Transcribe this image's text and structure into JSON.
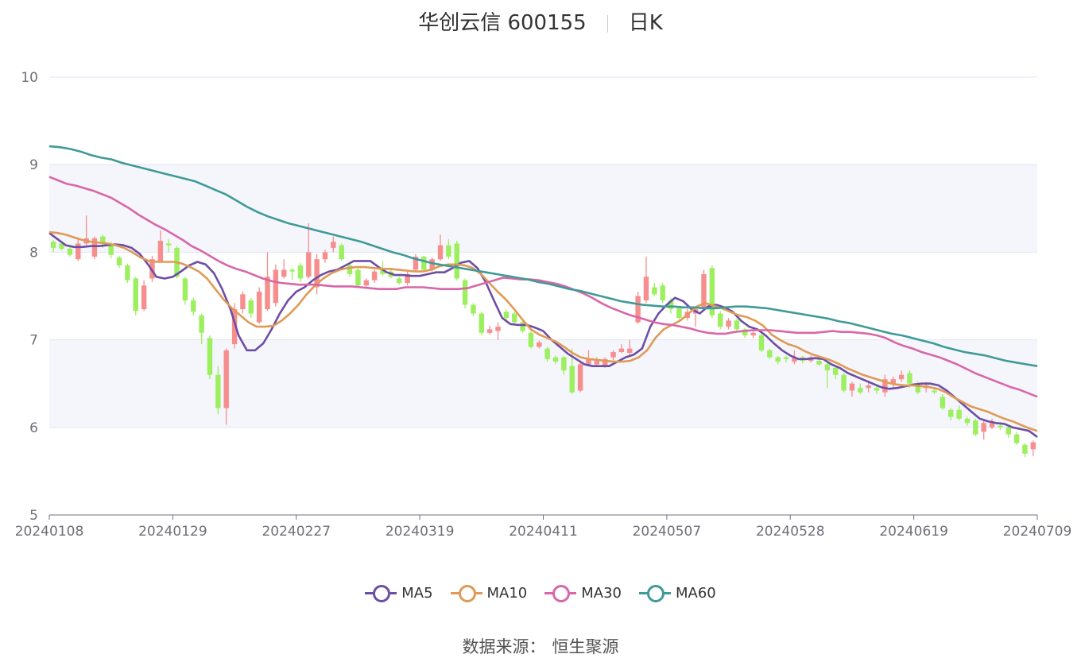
{
  "header": {
    "stock": "华创云信 600155",
    "period": "日K"
  },
  "source": {
    "label": "数据来源：",
    "provider": "恒生聚源"
  },
  "colors": {
    "up": "#f78e8e",
    "down": "#9cef5e",
    "ma5": "#6d4ea5",
    "ma10": "#e09a56",
    "ma30": "#d966a8",
    "ma60": "#3f9a98",
    "band": "#f4f6fb",
    "grid": "#dfe6f3"
  },
  "chart_data": {
    "type": "candlestick",
    "yaxis": {
      "min": 5,
      "max": 10,
      "ticks": [
        "5",
        "6",
        "7",
        "8",
        "9",
        "10"
      ]
    },
    "xaxis": {
      "ticks": [
        "20240108",
        "20240129",
        "20240227",
        "20240319",
        "20240411",
        "20240507",
        "20240528",
        "20240619",
        "20240709"
      ]
    },
    "legend": [
      "MA5",
      "MA10",
      "MA30",
      "MA60"
    ],
    "series": [
      {
        "name": "MA5",
        "values": [
          8.22,
          8.15,
          8.08,
          8.06,
          8.06,
          8.07,
          8.07,
          8.08,
          8.09,
          8.08,
          8.05,
          7.98,
          7.86,
          7.72,
          7.7,
          7.72,
          7.78,
          7.85,
          7.89,
          7.86,
          7.76,
          7.58,
          7.35,
          7.05,
          6.88,
          6.88,
          6.96,
          7.12,
          7.3,
          7.45,
          7.55,
          7.6,
          7.68,
          7.74,
          7.78,
          7.8,
          7.85,
          7.9,
          7.9,
          7.9,
          7.83,
          7.77,
          7.74,
          7.74,
          7.73,
          7.73,
          7.75,
          7.77,
          7.77,
          7.82,
          7.88,
          7.9,
          7.82,
          7.66,
          7.45,
          7.25,
          7.18,
          7.17,
          7.17,
          7.14,
          7.1,
          7.0,
          6.92,
          6.84,
          6.78,
          6.72,
          6.7,
          6.7,
          6.7,
          6.75,
          6.8,
          6.83,
          6.9,
          7.15,
          7.3,
          7.4,
          7.48,
          7.44,
          7.35,
          7.3,
          7.38,
          7.4,
          7.37,
          7.32,
          7.22,
          7.15,
          7.12,
          7.05,
          6.96,
          6.88,
          6.82,
          6.78,
          6.78,
          6.79,
          6.78,
          6.72,
          6.68,
          6.62,
          6.58,
          6.54,
          6.5,
          6.46,
          6.44,
          6.45,
          6.47,
          6.49,
          6.5,
          6.5,
          6.48,
          6.42,
          6.34,
          6.26,
          6.18,
          6.1,
          6.07,
          6.05,
          6.04,
          6.0,
          5.98,
          5.96,
          5.89
        ]
      },
      {
        "name": "MA10",
        "values": [
          8.23,
          8.22,
          8.2,
          8.17,
          8.14,
          8.12,
          8.11,
          8.1,
          8.08,
          8.05,
          8.0,
          7.94,
          7.9,
          7.89,
          7.89,
          7.89,
          7.87,
          7.83,
          7.78,
          7.7,
          7.58,
          7.46,
          7.36,
          7.28,
          7.2,
          7.15,
          7.15,
          7.16,
          7.22,
          7.3,
          7.4,
          7.52,
          7.62,
          7.7,
          7.76,
          7.8,
          7.82,
          7.83,
          7.83,
          7.82,
          7.81,
          7.81,
          7.8,
          7.79,
          7.78,
          7.78,
          7.8,
          7.84,
          7.86,
          7.86,
          7.85,
          7.82,
          7.75,
          7.65,
          7.55,
          7.46,
          7.35,
          7.23,
          7.12,
          7.06,
          7.02,
          6.98,
          6.92,
          6.85,
          6.8,
          6.78,
          6.77,
          6.76,
          6.75,
          6.75,
          6.76,
          6.8,
          6.88,
          7.02,
          7.12,
          7.17,
          7.22,
          7.3,
          7.38,
          7.42,
          7.39,
          7.36,
          7.32,
          7.28,
          7.26,
          7.22,
          7.16,
          7.06,
          7.0,
          6.95,
          6.92,
          6.87,
          6.83,
          6.8,
          6.77,
          6.73,
          6.68,
          6.64,
          6.6,
          6.57,
          6.54,
          6.51,
          6.49,
          6.48,
          6.48,
          6.47,
          6.46,
          6.44,
          6.4,
          6.34,
          6.29,
          6.24,
          6.21,
          6.18,
          6.14,
          6.1,
          6.07,
          6.03,
          5.99,
          5.96
        ]
      },
      {
        "name": "MA30",
        "values": [
          8.86,
          8.82,
          8.78,
          8.76,
          8.73,
          8.7,
          8.66,
          8.62,
          8.56,
          8.5,
          8.43,
          8.37,
          8.31,
          8.26,
          8.2,
          8.14,
          8.07,
          8.02,
          7.96,
          7.9,
          7.85,
          7.81,
          7.78,
          7.74,
          7.7,
          7.67,
          7.65,
          7.64,
          7.63,
          7.63,
          7.63,
          7.62,
          7.61,
          7.61,
          7.61,
          7.6,
          7.59,
          7.58,
          7.58,
          7.58,
          7.6,
          7.6,
          7.6,
          7.59,
          7.58,
          7.58,
          7.58,
          7.59,
          7.62,
          7.65,
          7.68,
          7.71,
          7.7,
          7.69,
          7.69,
          7.68,
          7.66,
          7.64,
          7.61,
          7.57,
          7.53,
          7.48,
          7.42,
          7.37,
          7.33,
          7.29,
          7.26,
          7.23,
          7.2,
          7.18,
          7.17,
          7.15,
          7.13,
          7.1,
          7.08,
          7.07,
          7.07,
          7.09,
          7.1,
          7.11,
          7.11,
          7.11,
          7.1,
          7.09,
          7.08,
          7.08,
          7.08,
          7.09,
          7.1,
          7.09,
          7.09,
          7.08,
          7.07,
          7.05,
          7.02,
          6.97,
          6.93,
          6.9,
          6.86,
          6.83,
          6.8,
          6.76,
          6.72,
          6.67,
          6.62,
          6.58,
          6.54,
          6.5,
          6.46,
          6.43,
          6.39,
          6.35
        ]
      },
      {
        "name": "MA60",
        "values": [
          9.21,
          9.2,
          9.18,
          9.15,
          9.11,
          9.08,
          9.06,
          9.02,
          8.99,
          8.96,
          8.93,
          8.9,
          8.87,
          8.84,
          8.81,
          8.76,
          8.71,
          8.66,
          8.59,
          8.52,
          8.46,
          8.41,
          8.37,
          8.33,
          8.3,
          8.27,
          8.24,
          8.21,
          8.18,
          8.15,
          8.12,
          8.08,
          8.04,
          8.0,
          7.97,
          7.93,
          7.9,
          7.87,
          7.85,
          7.83,
          7.81,
          7.79,
          7.77,
          7.75,
          7.73,
          7.71,
          7.69,
          7.66,
          7.64,
          7.61,
          7.58,
          7.56,
          7.53,
          7.5,
          7.47,
          7.44,
          7.42,
          7.4,
          7.39,
          7.38,
          7.38,
          7.37,
          7.37,
          7.36,
          7.36,
          7.37,
          7.38,
          7.38,
          7.37,
          7.36,
          7.34,
          7.32,
          7.3,
          7.28,
          7.26,
          7.24,
          7.21,
          7.19,
          7.16,
          7.13,
          7.1,
          7.07,
          7.05,
          7.02,
          6.99,
          6.96,
          6.92,
          6.89,
          6.86,
          6.84,
          6.82,
          6.79,
          6.76,
          6.74,
          6.72,
          6.7
        ]
      }
    ],
    "candles": [
      {
        "o": 8.12,
        "c": 8.05,
        "h": 8.14,
        "l": 8.0
      },
      {
        "o": 8.1,
        "c": 8.04,
        "h": 8.12,
        "l": 8.02
      },
      {
        "o": 8.04,
        "c": 7.97,
        "h": 8.06,
        "l": 7.95
      },
      {
        "o": 7.92,
        "c": 8.1,
        "h": 8.15,
        "l": 7.9
      },
      {
        "o": 8.1,
        "c": 8.16,
        "h": 8.42,
        "l": 8.08
      },
      {
        "o": 7.95,
        "c": 8.16,
        "h": 8.18,
        "l": 7.92
      },
      {
        "o": 8.18,
        "c": 8.1,
        "h": 8.2,
        "l": 8.05
      },
      {
        "o": 8.1,
        "c": 7.97,
        "h": 8.12,
        "l": 7.93
      },
      {
        "o": 7.94,
        "c": 7.85,
        "h": 7.96,
        "l": 7.82
      },
      {
        "o": 7.85,
        "c": 7.68,
        "h": 7.87,
        "l": 7.65
      },
      {
        "o": 7.7,
        "c": 7.33,
        "h": 7.72,
        "l": 7.28
      },
      {
        "o": 7.35,
        "c": 7.62,
        "h": 7.68,
        "l": 7.33
      },
      {
        "o": 7.7,
        "c": 7.92,
        "h": 7.96,
        "l": 7.66
      },
      {
        "o": 7.9,
        "c": 8.13,
        "h": 8.25,
        "l": 7.88
      },
      {
        "o": 8.1,
        "c": 8.08,
        "h": 8.15,
        "l": 8.0
      },
      {
        "o": 8.05,
        "c": 7.72,
        "h": 8.07,
        "l": 7.7
      },
      {
        "o": 7.7,
        "c": 7.45,
        "h": 7.72,
        "l": 7.4
      },
      {
        "o": 7.45,
        "c": 7.32,
        "h": 7.48,
        "l": 7.28
      },
      {
        "o": 7.28,
        "c": 7.08,
        "h": 7.3,
        "l": 6.95
      },
      {
        "o": 7.02,
        "c": 6.6,
        "h": 7.05,
        "l": 6.55
      },
      {
        "o": 6.6,
        "c": 6.22,
        "h": 6.7,
        "l": 6.15
      },
      {
        "o": 6.22,
        "c": 6.88,
        "h": 6.9,
        "l": 6.03
      },
      {
        "o": 6.95,
        "c": 7.35,
        "h": 7.42,
        "l": 6.9
      },
      {
        "o": 7.35,
        "c": 7.52,
        "h": 7.55,
        "l": 7.3
      },
      {
        "o": 7.45,
        "c": 7.3,
        "h": 7.48,
        "l": 7.25
      },
      {
        "o": 7.2,
        "c": 7.55,
        "h": 7.6,
        "l": 7.18
      },
      {
        "o": 7.35,
        "c": 7.72,
        "h": 8.0,
        "l": 7.33
      },
      {
        "o": 7.42,
        "c": 7.8,
        "h": 7.86,
        "l": 7.38
      },
      {
        "o": 7.72,
        "c": 7.8,
        "h": 7.92,
        "l": 7.7
      },
      {
        "o": 7.8,
        "c": 7.78,
        "h": 7.82,
        "l": 7.68
      },
      {
        "o": 7.85,
        "c": 7.7,
        "h": 7.88,
        "l": 7.66
      },
      {
        "o": 7.72,
        "c": 8.0,
        "h": 8.33,
        "l": 7.7
      },
      {
        "o": 7.6,
        "c": 7.92,
        "h": 7.98,
        "l": 7.52
      },
      {
        "o": 7.92,
        "c": 8.0,
        "h": 8.03,
        "l": 7.88
      },
      {
        "o": 8.05,
        "c": 8.12,
        "h": 8.18,
        "l": 8.0
      },
      {
        "o": 8.08,
        "c": 7.92,
        "h": 8.1,
        "l": 7.9
      },
      {
        "o": 7.85,
        "c": 7.75,
        "h": 7.87,
        "l": 7.72
      },
      {
        "o": 7.8,
        "c": 7.62,
        "h": 7.82,
        "l": 7.6
      },
      {
        "o": 7.62,
        "c": 7.68,
        "h": 7.7,
        "l": 7.6
      },
      {
        "o": 7.68,
        "c": 7.78,
        "h": 7.8,
        "l": 7.65
      },
      {
        "o": 7.8,
        "c": 7.75,
        "h": 7.9,
        "l": 7.73
      },
      {
        "o": 7.78,
        "c": 7.72,
        "h": 7.8,
        "l": 7.7
      },
      {
        "o": 7.7,
        "c": 7.65,
        "h": 7.72,
        "l": 7.63
      },
      {
        "o": 7.65,
        "c": 7.75,
        "h": 7.78,
        "l": 7.62
      },
      {
        "o": 7.8,
        "c": 7.95,
        "h": 7.98,
        "l": 7.78
      },
      {
        "o": 7.95,
        "c": 7.8,
        "h": 7.96,
        "l": 7.78
      },
      {
        "o": 7.8,
        "c": 7.92,
        "h": 7.94,
        "l": 7.78
      },
      {
        "o": 7.92,
        "c": 8.08,
        "h": 8.2,
        "l": 7.9
      },
      {
        "o": 8.08,
        "c": 7.95,
        "h": 8.15,
        "l": 7.92
      },
      {
        "o": 8.1,
        "c": 7.7,
        "h": 8.13,
        "l": 7.68
      },
      {
        "o": 7.68,
        "c": 7.4,
        "h": 7.7,
        "l": 7.36
      },
      {
        "o": 7.4,
        "c": 7.3,
        "h": 7.42,
        "l": 7.27
      },
      {
        "o": 7.3,
        "c": 7.08,
        "h": 7.32,
        "l": 7.05
      },
      {
        "o": 7.08,
        "c": 7.12,
        "h": 7.16,
        "l": 7.06
      },
      {
        "o": 7.1,
        "c": 7.15,
        "h": 7.2,
        "l": 7.0
      },
      {
        "o": 7.32,
        "c": 7.25,
        "h": 7.35,
        "l": 7.2
      },
      {
        "o": 7.3,
        "c": 7.2,
        "h": 7.32,
        "l": 7.17
      },
      {
        "o": 7.2,
        "c": 7.1,
        "h": 7.22,
        "l": 7.08
      },
      {
        "o": 7.08,
        "c": 6.92,
        "h": 7.1,
        "l": 6.9
      },
      {
        "o": 6.92,
        "c": 6.97,
        "h": 6.99,
        "l": 6.9
      },
      {
        "o": 6.9,
        "c": 6.78,
        "h": 6.92,
        "l": 6.75
      },
      {
        "o": 6.8,
        "c": 6.75,
        "h": 6.82,
        "l": 6.72
      },
      {
        "o": 6.8,
        "c": 6.65,
        "h": 6.82,
        "l": 6.6
      },
      {
        "o": 6.7,
        "c": 6.4,
        "h": 6.9,
        "l": 6.38
      },
      {
        "o": 6.42,
        "c": 6.72,
        "h": 6.75,
        "l": 6.4
      },
      {
        "o": 6.72,
        "c": 6.78,
        "h": 6.88,
        "l": 6.7
      },
      {
        "o": 6.72,
        "c": 6.76,
        "h": 6.8,
        "l": 6.7
      },
      {
        "o": 6.7,
        "c": 6.78,
        "h": 6.8,
        "l": 6.68
      },
      {
        "o": 6.8,
        "c": 6.86,
        "h": 6.88,
        "l": 6.77
      },
      {
        "o": 6.86,
        "c": 6.9,
        "h": 6.95,
        "l": 6.85
      },
      {
        "o": 6.85,
        "c": 6.9,
        "h": 7.0,
        "l": 6.82
      },
      {
        "o": 7.2,
        "c": 7.5,
        "h": 7.55,
        "l": 7.18
      },
      {
        "o": 7.45,
        "c": 7.72,
        "h": 7.95,
        "l": 7.42
      },
      {
        "o": 7.6,
        "c": 7.52,
        "h": 7.65,
        "l": 7.5
      },
      {
        "o": 7.62,
        "c": 7.45,
        "h": 7.65,
        "l": 7.42
      },
      {
        "o": 7.45,
        "c": 7.35,
        "h": 7.48,
        "l": 7.3
      },
      {
        "o": 7.36,
        "c": 7.25,
        "h": 7.38,
        "l": 7.23
      },
      {
        "o": 7.25,
        "c": 7.32,
        "h": 7.35,
        "l": 7.22
      },
      {
        "o": 7.3,
        "c": 7.35,
        "h": 7.38,
        "l": 7.15
      },
      {
        "o": 7.35,
        "c": 7.75,
        "h": 7.8,
        "l": 7.33
      },
      {
        "o": 7.82,
        "c": 7.28,
        "h": 7.85,
        "l": 7.25
      },
      {
        "o": 7.3,
        "c": 7.15,
        "h": 7.33,
        "l": 7.12
      },
      {
        "o": 7.15,
        "c": 7.22,
        "h": 7.25,
        "l": 7.12
      },
      {
        "o": 7.22,
        "c": 7.12,
        "h": 7.24,
        "l": 7.1
      },
      {
        "o": 7.12,
        "c": 7.05,
        "h": 7.14,
        "l": 7.02
      },
      {
        "o": 7.05,
        "c": 7.08,
        "h": 7.1,
        "l": 7.02
      },
      {
        "o": 7.05,
        "c": 6.88,
        "h": 7.07,
        "l": 6.86
      },
      {
        "o": 6.88,
        "c": 6.8,
        "h": 6.9,
        "l": 6.78
      },
      {
        "o": 6.8,
        "c": 6.75,
        "h": 6.82,
        "l": 6.72
      },
      {
        "o": 6.8,
        "c": 6.78,
        "h": 6.82,
        "l": 6.74
      },
      {
        "o": 6.75,
        "c": 6.8,
        "h": 6.88,
        "l": 6.72
      },
      {
        "o": 6.8,
        "c": 6.76,
        "h": 6.82,
        "l": 6.73
      },
      {
        "o": 6.76,
        "c": 6.8,
        "h": 6.82,
        "l": 6.74
      },
      {
        "o": 6.76,
        "c": 6.72,
        "h": 6.8,
        "l": 6.7
      },
      {
        "o": 6.72,
        "c": 6.65,
        "h": 6.75,
        "l": 6.45
      },
      {
        "o": 6.68,
        "c": 6.6,
        "h": 6.7,
        "l": 6.55
      },
      {
        "o": 6.6,
        "c": 6.42,
        "h": 6.62,
        "l": 6.4
      },
      {
        "o": 6.42,
        "c": 6.5,
        "h": 6.52,
        "l": 6.35
      },
      {
        "o": 6.45,
        "c": 6.4,
        "h": 6.5,
        "l": 6.38
      },
      {
        "o": 6.45,
        "c": 6.48,
        "h": 6.52,
        "l": 6.4
      },
      {
        "o": 6.45,
        "c": 6.42,
        "h": 6.48,
        "l": 6.38
      },
      {
        "o": 6.4,
        "c": 6.55,
        "h": 6.6,
        "l": 6.35
      },
      {
        "o": 6.5,
        "c": 6.55,
        "h": 6.58,
        "l": 6.45
      },
      {
        "o": 6.55,
        "c": 6.6,
        "h": 6.65,
        "l": 6.52
      },
      {
        "o": 6.62,
        "c": 6.5,
        "h": 6.65,
        "l": 6.45
      },
      {
        "o": 6.5,
        "c": 6.4,
        "h": 6.52,
        "l": 6.38
      },
      {
        "o": 6.45,
        "c": 6.48,
        "h": 6.52,
        "l": 6.4
      },
      {
        "o": 6.42,
        "c": 6.4,
        "h": 6.44,
        "l": 6.38
      },
      {
        "o": 6.35,
        "c": 6.22,
        "h": 6.38,
        "l": 6.2
      },
      {
        "o": 6.2,
        "c": 6.12,
        "h": 6.22,
        "l": 6.08
      },
      {
        "o": 6.2,
        "c": 6.1,
        "h": 6.25,
        "l": 6.08
      },
      {
        "o": 6.1,
        "c": 6.05,
        "h": 6.12,
        "l": 6.02
      },
      {
        "o": 6.08,
        "c": 5.92,
        "h": 6.1,
        "l": 5.9
      },
      {
        "o": 5.95,
        "c": 6.05,
        "h": 6.08,
        "l": 5.86
      },
      {
        "o": 6.0,
        "c": 6.05,
        "h": 6.1,
        "l": 5.98
      },
      {
        "o": 6.02,
        "c": 6.0,
        "h": 6.06,
        "l": 5.97
      },
      {
        "o": 6.0,
        "c": 5.92,
        "h": 6.02,
        "l": 5.88
      },
      {
        "o": 5.92,
        "c": 5.82,
        "h": 5.95,
        "l": 5.8
      },
      {
        "o": 5.8,
        "c": 5.7,
        "h": 5.82,
        "l": 5.66
      },
      {
        "o": 5.75,
        "c": 5.83,
        "h": 5.85,
        "l": 5.67
      }
    ]
  }
}
